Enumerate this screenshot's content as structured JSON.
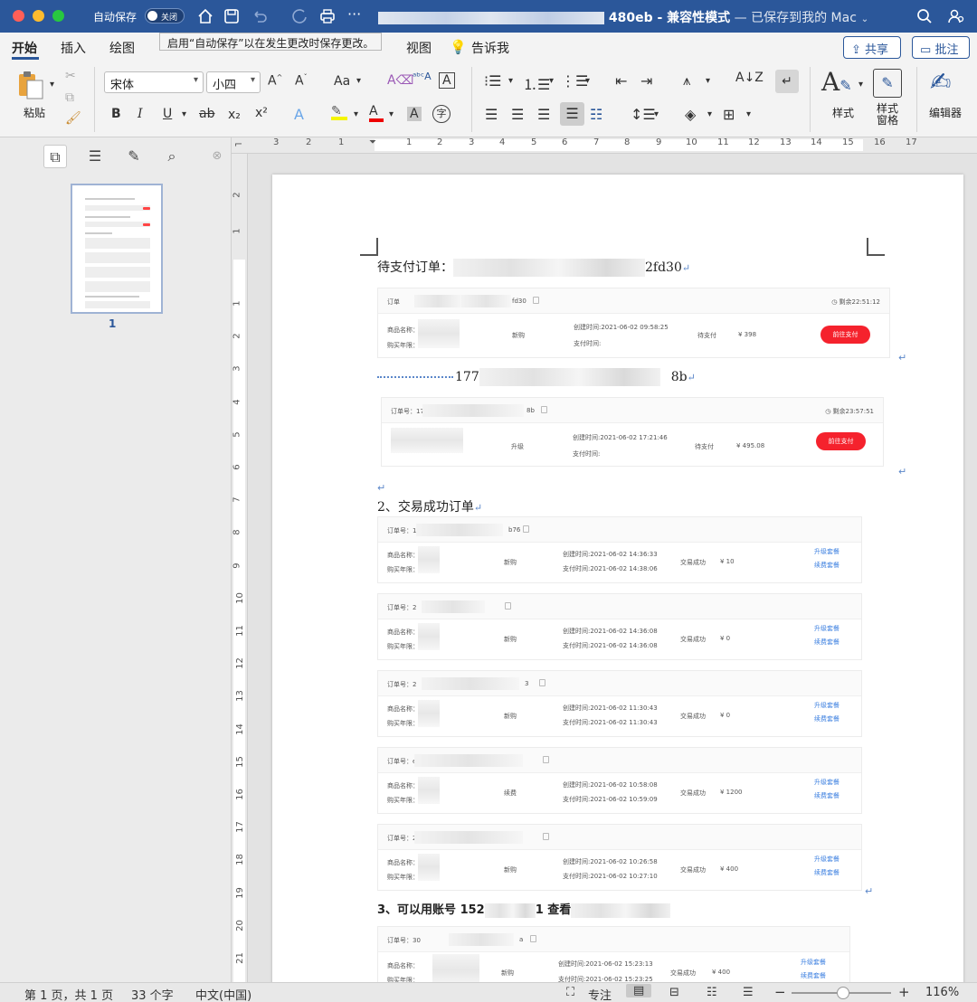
{
  "titlebar": {
    "autosave_label": "自动保存",
    "autosave_state": "关闭",
    "doc_name_suffix": "480eb",
    "compat_mode": " - 兼容性模式",
    "saved_status": " — 已保存到我的 Mac"
  },
  "tooltip": "启用“自动保存”以在发生更改时保存更改。",
  "tabs": [
    "开始",
    "插入",
    "绘图",
    "视图",
    "告诉我"
  ],
  "actions": {
    "share": "共享",
    "comment": "批注"
  },
  "ribbon": {
    "paste": "粘贴",
    "font_name": "宋体",
    "font_size": "小四",
    "bold": "B",
    "italic": "I",
    "underline": "U",
    "strike": "ab",
    "subscript": "x₂",
    "superscript": "x²",
    "case": "Aa",
    "styles": "样式",
    "styles_pane": "样式\n窗格",
    "editor": "编辑器"
  },
  "sidebar": {
    "page_number": "1"
  },
  "ruler": {
    "h_numbers": [
      "3",
      "2",
      "1",
      "1",
      "2",
      "3",
      "4",
      "5",
      "6",
      "7",
      "8",
      "9",
      "10",
      "11",
      "12",
      "13",
      "14",
      "15",
      "16",
      "17"
    ],
    "v_numbers": [
      "2",
      "1",
      "1",
      "2",
      "3",
      "4",
      "5",
      "6",
      "7",
      "8",
      "9",
      "10",
      "11",
      "12",
      "13",
      "14",
      "15",
      "16",
      "17",
      "18",
      "19",
      "20",
      "21"
    ]
  },
  "document": {
    "heading_pending": "待支付订单：",
    "heading_pending_tail": "2fd30",
    "line2_head": "177",
    "line2_tail": "8b",
    "heading_success": "2、交易成功订单",
    "heading_account_a": "3、可以用账号 152",
    "heading_account_b": "1 查看",
    "pending_orders": [
      {
        "order_label": "订单",
        "order_tail": "fd30",
        "countdown": "剩余22:51:12",
        "product_label": "商品名称：",
        "years_label": "购买年限：",
        "type": "新购",
        "created": "创建时间:2021-06-02 09:58:25",
        "paid": "支付时间:",
        "status": "待支付",
        "amount": "¥ 398",
        "button": "前往支付"
      },
      {
        "order_label": "订单号：17",
        "order_tail": "8b",
        "countdown": "剩余23:57:51",
        "type": "升级",
        "created": "创建时间:2021-06-02 17:21:46",
        "paid": "支付时间:",
        "status": "待支付",
        "amount": "¥ 495.08",
        "button": "前往支付"
      }
    ],
    "success_orders": [
      {
        "order_label": "订单号：1a",
        "order_tail": "b76",
        "type": "新购",
        "created": "创建时间:2021-06-02 14:36:33",
        "paid": "支付时间:2021-06-02 14:38:06",
        "status": "交易成功",
        "amount": "¥ 10",
        "link1": "升级套餐",
        "link2": "续费套餐"
      },
      {
        "order_label": "订单号：2",
        "order_tail": "",
        "type": "新购",
        "created": "创建时间:2021-06-02 14:36:08",
        "paid": "支付时间:2021-06-02 14:36:08",
        "status": "交易成功",
        "amount": "¥ 0",
        "link1": "升级套餐",
        "link2": "续费套餐"
      },
      {
        "order_label": "订单号：2",
        "order_tail": "3",
        "type": "新购",
        "created": "创建时间:2021-06-02 11:30:43",
        "paid": "支付时间:2021-06-02 11:30:43",
        "status": "交易成功",
        "amount": "¥ 0",
        "link1": "升级套餐",
        "link2": "续费套餐"
      },
      {
        "order_label": "订单号：ef",
        "order_tail": "",
        "type": "续费",
        "created": "创建时间:2021-06-02 10:58:08",
        "paid": "支付时间:2021-06-02 10:59:09",
        "status": "交易成功",
        "amount": "¥ 1200",
        "link1": "升级套餐",
        "link2": "续费套餐"
      },
      {
        "order_label": "订单号：2",
        "order_tail": "",
        "type": "新购",
        "created": "创建时间:2021-06-02 10:26:58",
        "paid": "支付时间:2021-06-02 10:27:10",
        "status": "交易成功",
        "amount": "¥ 400",
        "link1": "升级套餐",
        "link2": "续费套餐"
      }
    ],
    "last_order": {
      "order_label": "订单号：30",
      "order_tail": "a",
      "type": "新购",
      "created": "创建时间:2021-06-02 15:23:13",
      "paid": "支付时间:2021-06-02 15:23:25",
      "status": "交易成功",
      "amount": "¥ 400",
      "link1": "升级套餐",
      "link2": "续费套餐"
    },
    "product_label": "商品名称：",
    "years_label": "购买年限："
  },
  "statusbar": {
    "page": "第 1 页，共 1 页",
    "words": "33 个字",
    "language": "中文(中国)",
    "focus": "专注",
    "zoom": "116%"
  },
  "colors": {
    "title_bar": "#2b579a",
    "pay_button": "#f5222d",
    "link": "#3b7fe0"
  }
}
